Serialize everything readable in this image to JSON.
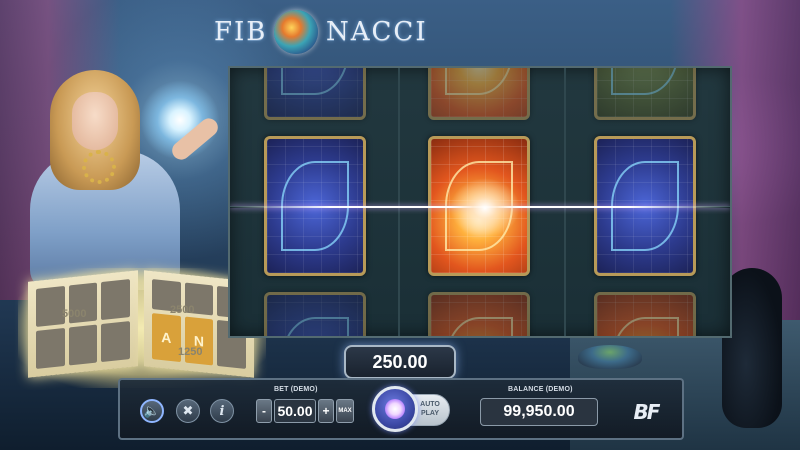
{
  "game": {
    "logo_left": "FIB",
    "logo_right": "NACCI"
  },
  "book": {
    "numbers": [
      "5000",
      "2500",
      "1250"
    ],
    "letters": [
      "A",
      "N"
    ]
  },
  "win": {
    "amount": "250.00"
  },
  "controls": {
    "sound_icon": "speaker-icon",
    "settings_icon": "tools-icon",
    "info_icon": "info-icon",
    "bet_label": "BET (DEMO)",
    "bet_value": "50.00",
    "bet_decrease": "-",
    "bet_increase": "+",
    "bet_max": "MAX",
    "autoplay_label": "AUTO PLAY",
    "balance_label": "BALANCE (DEMO)",
    "balance_value": "99,950.00",
    "brand": "BF"
  },
  "reels": {
    "columns": 3,
    "visible_rows": 3,
    "grid": [
      [
        "blue-card",
        "fire-card",
        "gold-card"
      ],
      [
        "blue-card",
        "fire-card",
        "blue-card"
      ],
      [
        "blue-card",
        "fire-card",
        "fire-card"
      ]
    ],
    "win_row": 2
  },
  "colors": {
    "frame_gold": "#b89a58",
    "spin_blue": "#3c49a6",
    "card_blue": "#2d3b8e",
    "card_fire": "#e2561e"
  }
}
